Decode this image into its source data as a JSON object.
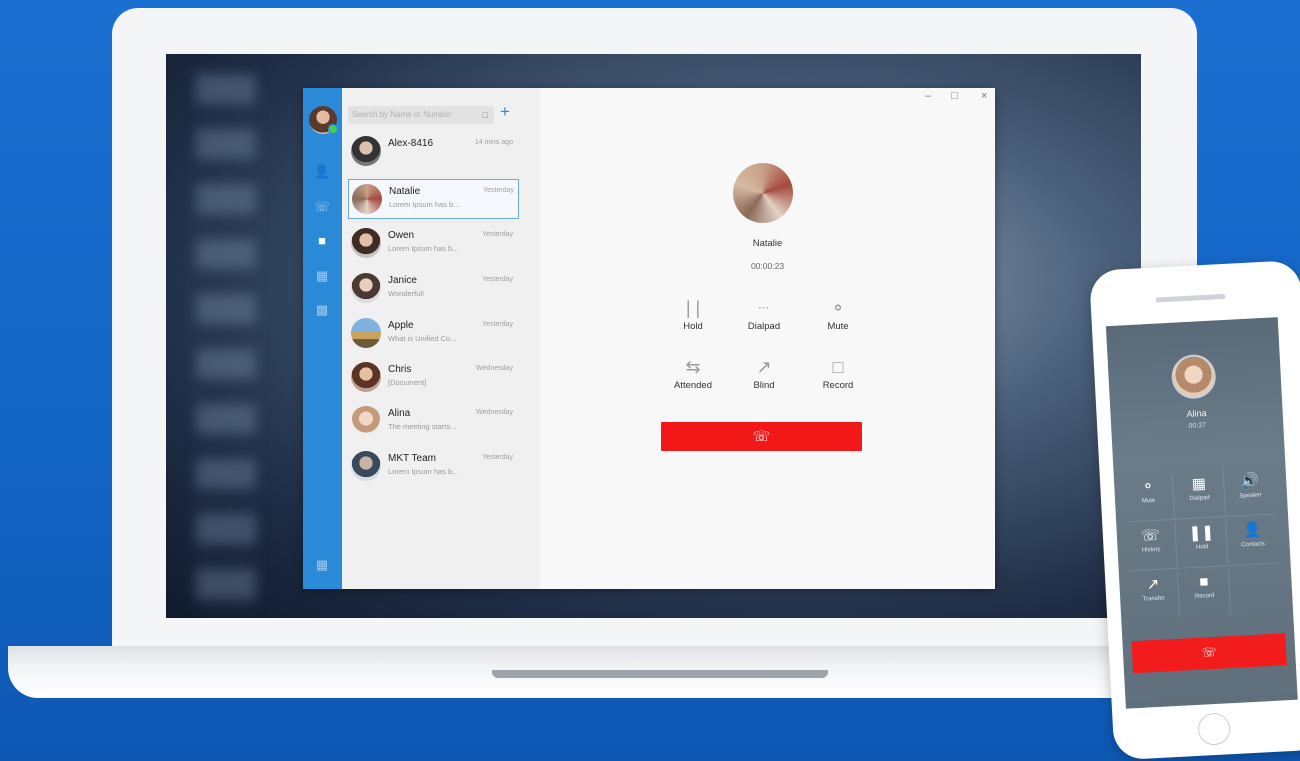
{
  "app": {
    "search_placeholder": "Search by Name or Number",
    "conversations": [
      {
        "name": "Alex-8416",
        "snippet": "",
        "time": "14 mins ago"
      },
      {
        "name": "Natalie",
        "snippet": "Lorem Ipsum has b...",
        "time": "Yesterday"
      },
      {
        "name": "Owen",
        "snippet": "Lorem Ipsum has b...",
        "time": "Yesterday"
      },
      {
        "name": "Janice",
        "snippet": "Wonderful!",
        "time": "Yesterday"
      },
      {
        "name": "Apple",
        "snippet": "What is Unified Co...",
        "time": "Yesterday"
      },
      {
        "name": "Chris",
        "snippet": "[Document]",
        "time": "Wednesday"
      },
      {
        "name": "Alina",
        "snippet": "The meeting starts...",
        "time": "Wednesday"
      },
      {
        "name": "MKT Team",
        "snippet": "Lorem Ipsum has b...",
        "time": "Yesterday"
      }
    ],
    "call": {
      "contact": "Natalie",
      "timer": "00:00:23",
      "controls": {
        "hold": "Hold",
        "dialpad": "Dialpad",
        "mute": "Mute",
        "attended": "Attended",
        "blind": "Blind",
        "record": "Record"
      }
    }
  },
  "phone": {
    "contact": "Alina",
    "timer": "00:37",
    "keys": {
      "mute": "Mute",
      "dialpad": "Dialpad",
      "speaker": "Speaker",
      "history": "History",
      "hold": "Hold",
      "contacts": "Contacts",
      "transfer": "Transfer",
      "record": "Record"
    }
  },
  "colors": {
    "background": "#1264c4",
    "rail": "#2a8ad8",
    "hangup": "#f31818"
  }
}
